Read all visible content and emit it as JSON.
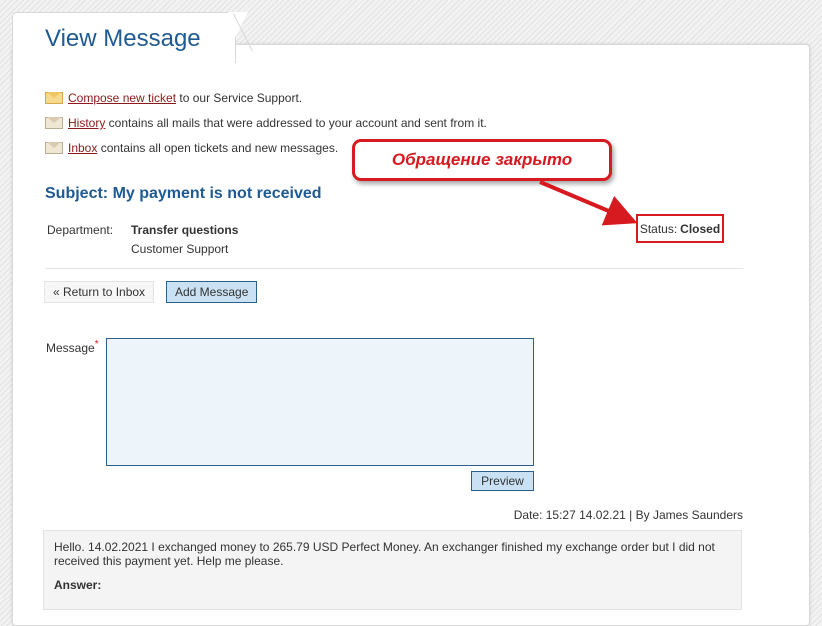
{
  "page": {
    "title": "View Message"
  },
  "info": {
    "compose": {
      "link": "Compose new ticket",
      "text": " to our Service Support."
    },
    "history": {
      "link": "History",
      "text": " contains all mails that were addressed to your account and sent from it."
    },
    "inbox": {
      "link": "Inbox",
      "text": " contains all open tickets and new messages."
    }
  },
  "ticket": {
    "subject": "Subject: My payment is not received",
    "department_label": "Department:",
    "department": "Transfer questions",
    "department_sub": "Customer Support",
    "status_label": "Status:",
    "status": "Closed"
  },
  "actions": {
    "return_label": "« Return to Inbox",
    "add_label": "Add Message",
    "preview_label": "Preview"
  },
  "form": {
    "message_label": "Message",
    "required_mark": "*",
    "message_value": ""
  },
  "thread": {
    "dateline": "Date: 15:27 14.02.21 | By James Saunders",
    "message": "Hello. 14.02.2021 I exchanged money to 265.79 USD Perfect Money. An exchanger finished my exchange order but I did not received this payment yet. Help me please.",
    "answer_label": "Answer:"
  },
  "annotation": {
    "callout_text": "Обращение закрыто",
    "color": "#d71920"
  },
  "colors": {
    "title": "#1f5a92",
    "link": "#8b1a1a",
    "button_bg": "#c9e1f3"
  },
  "icons": {
    "info_icon": "envelope-icon"
  }
}
